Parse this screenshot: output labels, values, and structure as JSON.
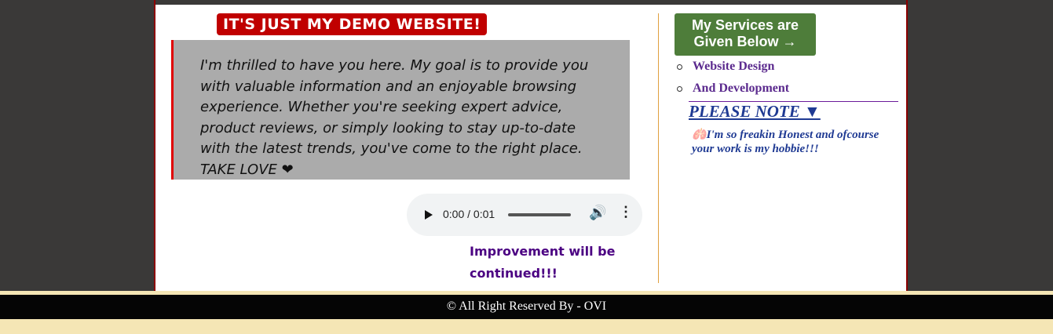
{
  "header": {
    "banner": "It's just my demo website!"
  },
  "main": {
    "intro_text": "I'm thrilled to have you here. My goal is to provide you with valuable information and an enjoyable browsing experience. Whether you're seeking expert advice, product reviews, or simply looking to stay up-to-date with the latest trends, you've come to the right place. TAKE LOVE ❤",
    "audio": {
      "time": "0:00 / 0:01",
      "progress": 0
    },
    "improvement_note": "Improvement will be continued!!!"
  },
  "sidebar": {
    "services_button": "My Services are Given Below →",
    "services": [
      "Website Design",
      "And Development"
    ],
    "note_title": "PLEASE NOTE ▼",
    "note_text": "🫁I'm so freakin Honest and ofcourse your work is my hobbie!!!"
  },
  "footer": {
    "copyright": "© All Right Reserved By - OVI"
  },
  "colors": {
    "banner_bg": "#c00000",
    "services_btn_bg": "#4e7d3a",
    "quote_bg": "#ababab",
    "note_color": "#1f3a93",
    "services_text": "#5b2a8e",
    "improve_text": "#4b0082"
  },
  "icons": {
    "play": "play-icon",
    "volume": "volume-icon",
    "more": "more-options-icon"
  }
}
